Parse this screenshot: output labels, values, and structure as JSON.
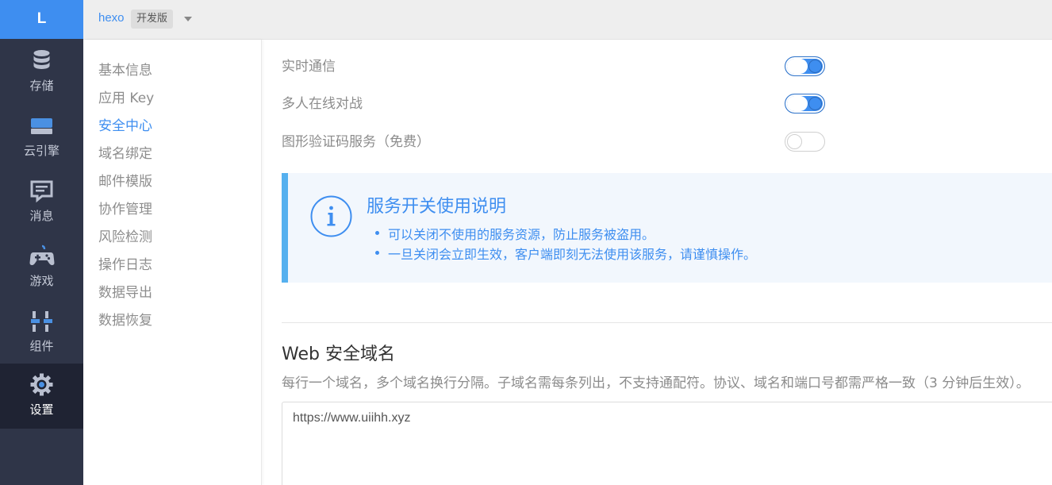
{
  "logo": {
    "letter": "L"
  },
  "rail": {
    "items": [
      {
        "label": "存储",
        "icon": "database-icon"
      },
      {
        "label": "云引擎",
        "icon": "cloud-engine-icon"
      },
      {
        "label": "消息",
        "icon": "message-icon"
      },
      {
        "label": "游戏",
        "icon": "gamepad-icon"
      },
      {
        "label": "组件",
        "icon": "components-icon"
      },
      {
        "label": "设置",
        "icon": "gear-icon",
        "active": true
      }
    ]
  },
  "topbar": {
    "app_name": "hexo",
    "env_badge": "开发版"
  },
  "subnav": {
    "items": [
      {
        "label": "基本信息"
      },
      {
        "label": "应用 Key"
      },
      {
        "label": "安全中心",
        "active": true
      },
      {
        "label": "域名绑定"
      },
      {
        "label": "邮件模版"
      },
      {
        "label": "协作管理"
      },
      {
        "label": "风险检测"
      },
      {
        "label": "操作日志"
      },
      {
        "label": "数据导出"
      },
      {
        "label": "数据恢复"
      }
    ]
  },
  "services": [
    {
      "label": "实时通信",
      "enabled": true
    },
    {
      "label": "多人在线对战",
      "enabled": true
    },
    {
      "label": "图形验证码服务（免费）",
      "enabled": false
    }
  ],
  "notice": {
    "icon": "info-icon",
    "title": "服务开关使用说明",
    "items": [
      "可以关闭不使用的服务资源，防止服务被盗用。",
      "一旦关闭会立即生效，客户端即刻无法使用该服务，请谨慎操作。"
    ]
  },
  "web_domains": {
    "title": "Web 安全域名",
    "description": "每行一个域名，多个域名换行分隔。子域名需每条列出，不支持通配符。协议、域名和端口号都需严格一致（3 分钟后生效）。",
    "value": "https://www.uiihh.xyz"
  },
  "colors": {
    "accent": "#3e8ef0",
    "rail_bg": "#2f3548",
    "rail_active_bg": "#1f2333",
    "notice_border": "#55b0ef"
  }
}
